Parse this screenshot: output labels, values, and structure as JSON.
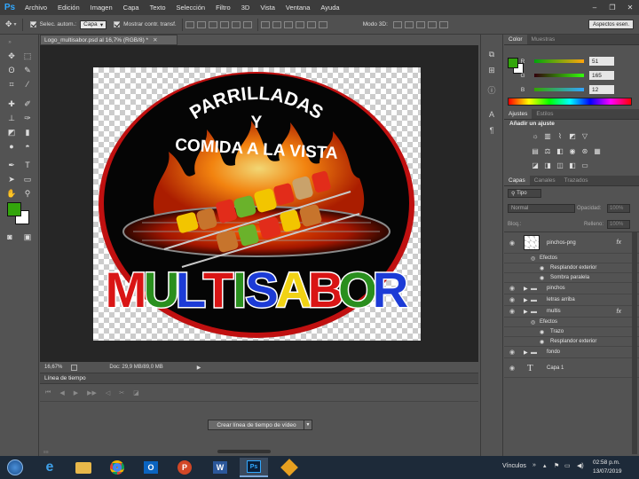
{
  "menubar": {
    "logo": "Ps",
    "items": [
      "Archivo",
      "Edición",
      "Imagen",
      "Capa",
      "Texto",
      "Selección",
      "Filtro",
      "3D",
      "Vista",
      "Ventana",
      "Ayuda"
    ],
    "window_controls": [
      "–",
      "❐",
      "✕"
    ]
  },
  "options": {
    "auto_select_label": "Selec. autom.:",
    "auto_select_value": "Capa",
    "show_transform_label": "Mostrar contr. transf.",
    "mode3d_label": "Modo 3D:",
    "workspace": "Aspectos esen."
  },
  "document": {
    "tab_title": "Logo_multisabor.psd al 16,7% (RGB/8) *",
    "zoom": "16,67%",
    "doc_info": "Doc: 29,9 MB/89,0 MB"
  },
  "artwork": {
    "line1": "PARRILLADAS",
    "line2": "Y",
    "line3": "COMIDA A LA VISTA",
    "brand_letters": [
      {
        "char": "M",
        "color": "#d91515"
      },
      {
        "char": "U",
        "color": "#2a8f1e"
      },
      {
        "char": "L",
        "color": "#1c3bd6"
      },
      {
        "char": "T",
        "color": "#d91515"
      },
      {
        "char": "I",
        "color": "#2a8f1e"
      },
      {
        "char": "S",
        "color": "#1c3bd6"
      },
      {
        "char": "A",
        "color": "#f1d314"
      },
      {
        "char": "B",
        "color": "#d91515"
      },
      {
        "char": "O",
        "color": "#2a8f1e"
      },
      {
        "char": "R",
        "color": "#1c3bd6"
      }
    ]
  },
  "timeline": {
    "title": "Línea de tiempo",
    "create_button": "Crear línea de tiempo de vídeo"
  },
  "color_panel": {
    "tabs": [
      "Color",
      "Muestras"
    ],
    "channels": [
      {
        "label": "R",
        "value": "51"
      },
      {
        "label": "G",
        "value": "165"
      },
      {
        "label": "B",
        "value": "12"
      }
    ],
    "foreground": "#33a50c",
    "background": "#ffffff"
  },
  "adjustments_panel": {
    "tabs": [
      "Ajustes",
      "Estilos"
    ],
    "heading": "Añadir un ajuste"
  },
  "layers_panel": {
    "tabs": [
      "Capas",
      "Canales",
      "Trazados"
    ],
    "filter": "Tipo",
    "blend_mode": "Normal",
    "opacity_label": "Opacidad:",
    "opacity_value": "100%",
    "lock_label": "Bloq.:",
    "fill_label": "Relleno:",
    "fill_value": "100%",
    "layers": [
      {
        "name": "pinchos-png",
        "kind": "image",
        "fx": true
      },
      {
        "name": "Efectos",
        "kind": "effects-header"
      },
      {
        "name": "Resplandor exterior",
        "kind": "effect"
      },
      {
        "name": "Sombra paralela",
        "kind": "effect"
      },
      {
        "name": "pinchos",
        "kind": "group"
      },
      {
        "name": "letras arriba",
        "kind": "group"
      },
      {
        "name": "multis",
        "kind": "group",
        "fx": true
      },
      {
        "name": "Efectos",
        "kind": "effects-header"
      },
      {
        "name": "Trazo",
        "kind": "effect"
      },
      {
        "name": "Resplandor exterior",
        "kind": "effect"
      },
      {
        "name": "fondo",
        "kind": "group"
      },
      {
        "name": "Capa 1",
        "kind": "text"
      }
    ]
  },
  "taskbar": {
    "links_label": "Vínculos",
    "time": "02:58 p.m.",
    "date": "13/07/2019"
  }
}
